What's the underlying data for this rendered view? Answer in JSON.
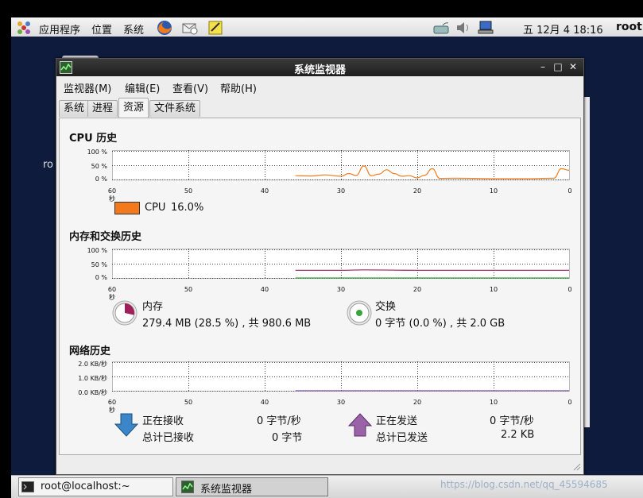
{
  "top_panel": {
    "menus": [
      "应用程序",
      "位置",
      "系统"
    ],
    "clock": "五 12月  4 18:16",
    "user": "root"
  },
  "desktop": {
    "partial_text": "ro"
  },
  "window": {
    "title": "系统监视器",
    "menubar": [
      "监视器(M)",
      "编辑(E)",
      "查看(V)",
      "帮助(H)"
    ],
    "tabs": [
      {
        "label": "系统",
        "active": false
      },
      {
        "label": "进程",
        "active": false
      },
      {
        "label": "资源",
        "active": true
      },
      {
        "label": "文件系统",
        "active": false
      }
    ]
  },
  "x_ticks": [
    "60 秒",
    "50",
    "40",
    "30",
    "20",
    "10",
    "0"
  ],
  "cpu": {
    "title": "CPU 历史",
    "y_ticks": [
      "100 %",
      "50 %",
      "0 %"
    ],
    "legend_label": "CPU",
    "legend_value": "16.0%",
    "color": "#f37a1c"
  },
  "memory": {
    "title": "内存和交换历史",
    "y_ticks": [
      "100 %",
      "50 %",
      "0 %"
    ],
    "mem_label": "内存",
    "mem_value": "279.4 MB (28.5 %) , 共 980.6 MB",
    "mem_color": "#a0205a",
    "swap_label": "交换",
    "swap_value": "0 字节 (0.0 %) , 共 2.0 GB",
    "swap_color": "#3aa33a"
  },
  "network": {
    "title": "网络历史",
    "y_ticks": [
      "2.0 KB/秒",
      "1.0 KB/秒",
      "0.0 KB/秒"
    ],
    "recv_label": "正在接收",
    "recv_value": "0 字节/秒",
    "recv_total_label": "总计已接收",
    "recv_total_value": "0 字节",
    "send_label": "正在发送",
    "send_value": "0 字节/秒",
    "send_total_label": "总计已发送",
    "send_total_value": "2.2 KB"
  },
  "taskbar": {
    "items": [
      {
        "label": "root@localhost:~",
        "icon": "terminal-icon"
      },
      {
        "label": "系统监视器",
        "icon": "system-monitor-icon"
      }
    ],
    "watermark": "https://blog.csdn.net/qq_45594685"
  },
  "chart_data": [
    {
      "type": "line",
      "title": "CPU 历史",
      "x_unit": "秒",
      "x": [
        36,
        34,
        32,
        30,
        29,
        28,
        27,
        26,
        25,
        24,
        23,
        22,
        21,
        20,
        19,
        18,
        17,
        15,
        10,
        5,
        2,
        1,
        0
      ],
      "series": [
        {
          "name": "CPU",
          "values": [
            14,
            13,
            17,
            12,
            22,
            15,
            50,
            14,
            20,
            36,
            22,
            12,
            14,
            6,
            16,
            40,
            4,
            5,
            3,
            3,
            5,
            40,
            34
          ]
        }
      ],
      "ylim": [
        0,
        100
      ],
      "xlim": [
        60,
        0
      ]
    },
    {
      "type": "line",
      "title": "内存和交换历史",
      "x_unit": "秒",
      "x": [
        36,
        30,
        27,
        20,
        10,
        0
      ],
      "series": [
        {
          "name": "内存",
          "values": [
            28.5,
            28.5,
            30,
            28.5,
            28.5,
            28.5
          ]
        },
        {
          "name": "交换",
          "values": [
            0,
            0,
            0,
            0,
            0,
            0
          ]
        }
      ],
      "ylim": [
        0,
        100
      ],
      "xlim": [
        60,
        0
      ]
    },
    {
      "type": "line",
      "title": "网络历史",
      "x_unit": "秒",
      "x": [
        36,
        0
      ],
      "series": [
        {
          "name": "正在接收",
          "values": [
            0,
            0
          ]
        },
        {
          "name": "正在发送",
          "values": [
            0,
            0
          ]
        }
      ],
      "ylim": [
        0,
        2.0
      ],
      "xlim": [
        60,
        0
      ]
    }
  ]
}
